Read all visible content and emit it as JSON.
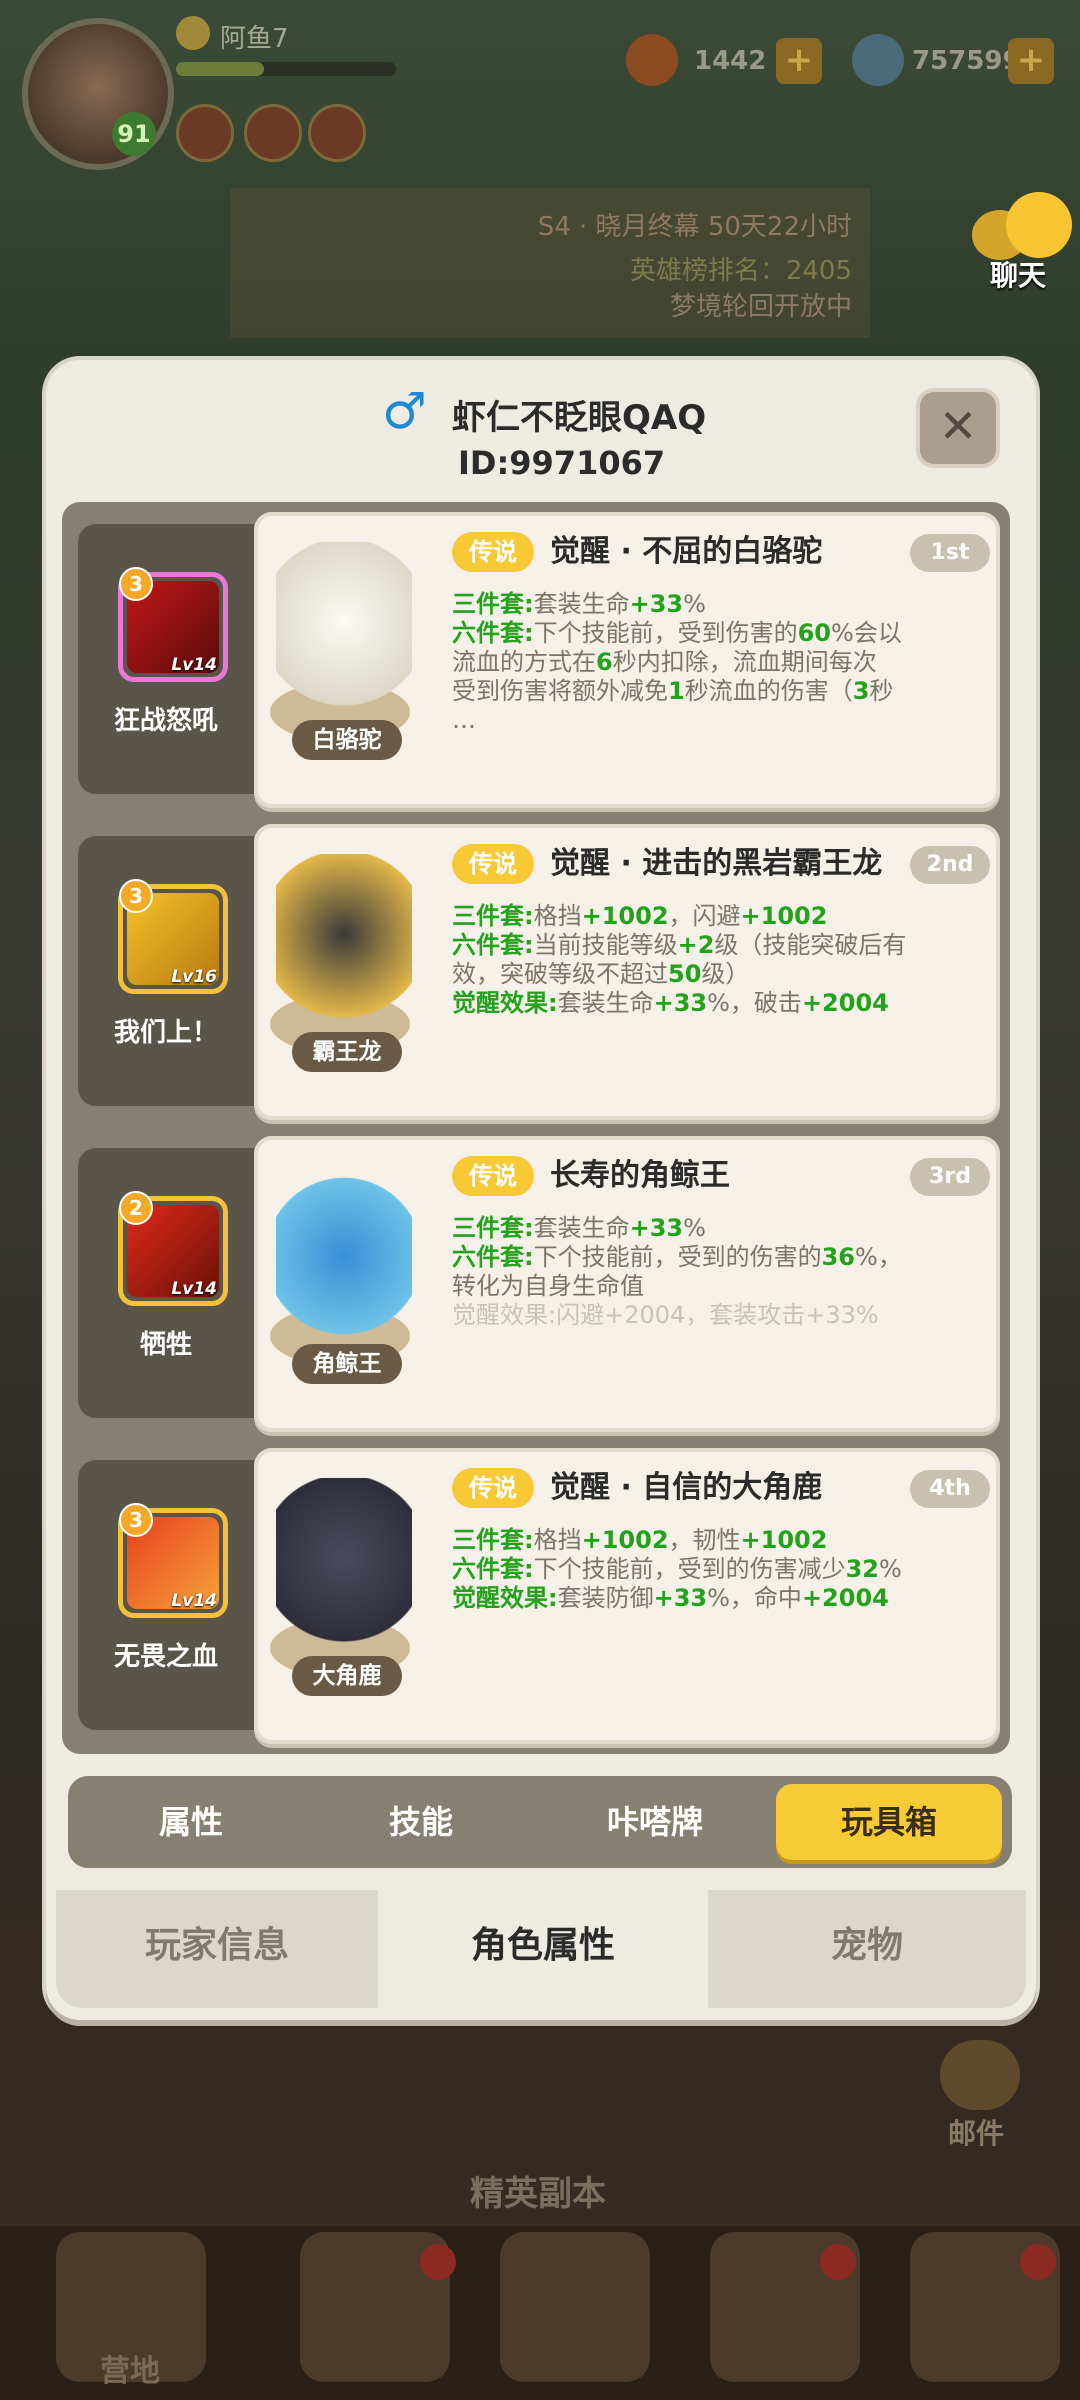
{
  "hud": {
    "player_name": "阿鱼7",
    "level": "91",
    "currency_1": "1442",
    "currency_2": "757599",
    "plus_symbol": "+"
  },
  "banner": {
    "season": "S4 · 晓月终幕  50天22小时",
    "rank": "英雄榜排名：2405",
    "dream": "梦境轮回开放中"
  },
  "side": {
    "chat_label": "聊天",
    "mail_label": "邮件",
    "elite_label": "精英副本",
    "camp_label": "营地"
  },
  "modal": {
    "gender_icon": "male-symbol",
    "gender_glyph": "♂",
    "title": "虾仁不眨眼QAQ",
    "id": "ID:9971067",
    "close_glyph": "✕"
  },
  "rows": [
    {
      "skill": {
        "name": "狂战怒吼",
        "stars": "3",
        "level": "Lv14",
        "frame": "pink"
      },
      "pet": {
        "name": "白骆驼"
      },
      "rarity": "传说",
      "item_name": "觉醒 · 不屈的白骆驼",
      "rank": "1st",
      "lines": [
        [
          [
            "g",
            "三件套:"
          ],
          [
            "t",
            "套装生命"
          ],
          [
            "g",
            "+33"
          ],
          [
            "t",
            "%"
          ]
        ],
        [
          [
            "g",
            "六件套:"
          ],
          [
            "t",
            "下个技能前，受到伤害的"
          ],
          [
            "g",
            "60"
          ],
          [
            "t",
            "%会以"
          ]
        ],
        [
          [
            "t",
            "流血的方式在"
          ],
          [
            "g",
            "6"
          ],
          [
            "t",
            "秒内扣除，流血期间每次"
          ]
        ],
        [
          [
            "t",
            "受到伤害将额外减免"
          ],
          [
            "g",
            "1"
          ],
          [
            "t",
            "秒流血的伤害（"
          ],
          [
            "g",
            "3"
          ],
          [
            "t",
            "秒"
          ]
        ],
        [
          [
            "t",
            "…"
          ]
        ]
      ]
    },
    {
      "skill": {
        "name": "我们上！",
        "stars": "3",
        "level": "Lv16",
        "frame": "gold"
      },
      "pet": {
        "name": "霸王龙"
      },
      "rarity": "传说",
      "item_name": "觉醒 · 进击的黑岩霸王龙",
      "rank": "2nd",
      "lines": [
        [
          [
            "g",
            "三件套:"
          ],
          [
            "t",
            "格挡"
          ],
          [
            "g",
            "+1002"
          ],
          [
            "t",
            "，闪避"
          ],
          [
            "g",
            "+1002"
          ]
        ],
        [
          [
            "g",
            "六件套:"
          ],
          [
            "t",
            "当前技能等级"
          ],
          [
            "g",
            "+2"
          ],
          [
            "t",
            "级（技能突破后有"
          ]
        ],
        [
          [
            "t",
            "效，突破等级不超过"
          ],
          [
            "g",
            "50"
          ],
          [
            "t",
            "级）"
          ]
        ],
        [
          [
            "g",
            "觉醒效果:"
          ],
          [
            "t",
            "套装生命"
          ],
          [
            "g",
            "+33"
          ],
          [
            "t",
            "%，破击"
          ],
          [
            "g",
            "+2004"
          ]
        ]
      ]
    },
    {
      "skill": {
        "name": "牺牲",
        "stars": "2",
        "level": "Lv14",
        "frame": "gold"
      },
      "pet": {
        "name": "角鲸王"
      },
      "rarity": "传说",
      "item_name": "长寿的角鲸王",
      "rank": "3rd",
      "lines": [
        [
          [
            "g",
            "三件套:"
          ],
          [
            "t",
            "套装生命"
          ],
          [
            "g",
            "+33"
          ],
          [
            "t",
            "%"
          ]
        ],
        [
          [
            "g",
            "六件套:"
          ],
          [
            "t",
            "下个技能前，受到的伤害的"
          ],
          [
            "g",
            "36"
          ],
          [
            "t",
            "%，"
          ]
        ],
        [
          [
            "t",
            "转化为自身生命值"
          ]
        ],
        [
          [
            "f",
            "觉醒效果:闪避+2004，套装攻击+33%"
          ]
        ]
      ]
    },
    {
      "skill": {
        "name": "无畏之血",
        "stars": "3",
        "level": "Lv14",
        "frame": "gold"
      },
      "pet": {
        "name": "大角鹿"
      },
      "rarity": "传说",
      "item_name": "觉醒 · 自信的大角鹿",
      "rank": "4th",
      "lines": [
        [
          [
            "g",
            "三件套:"
          ],
          [
            "t",
            "格挡"
          ],
          [
            "g",
            "+1002"
          ],
          [
            "t",
            "，韧性"
          ],
          [
            "g",
            "+1002"
          ]
        ],
        [
          [
            "g",
            "六件套:"
          ],
          [
            "t",
            "下个技能前，受到的伤害减少"
          ],
          [
            "g",
            "32"
          ],
          [
            "t",
            "%"
          ]
        ],
        [
          [
            "g",
            "觉醒效果:"
          ],
          [
            "t",
            "套装防御"
          ],
          [
            "g",
            "+33"
          ],
          [
            "t",
            "%，命中"
          ],
          [
            "g",
            "+2004"
          ]
        ]
      ]
    }
  ],
  "tabs": [
    "属性",
    "技能",
    "咔嗒牌",
    "玩具箱"
  ],
  "active_tab": 3,
  "bottom_tabs": [
    "玩家信息",
    "角色属性",
    "宠物"
  ],
  "active_bottom_tab": 1,
  "colors": {
    "green": "#23a21c",
    "gold": "#f6cb35",
    "cream": "#f5f1e8"
  }
}
